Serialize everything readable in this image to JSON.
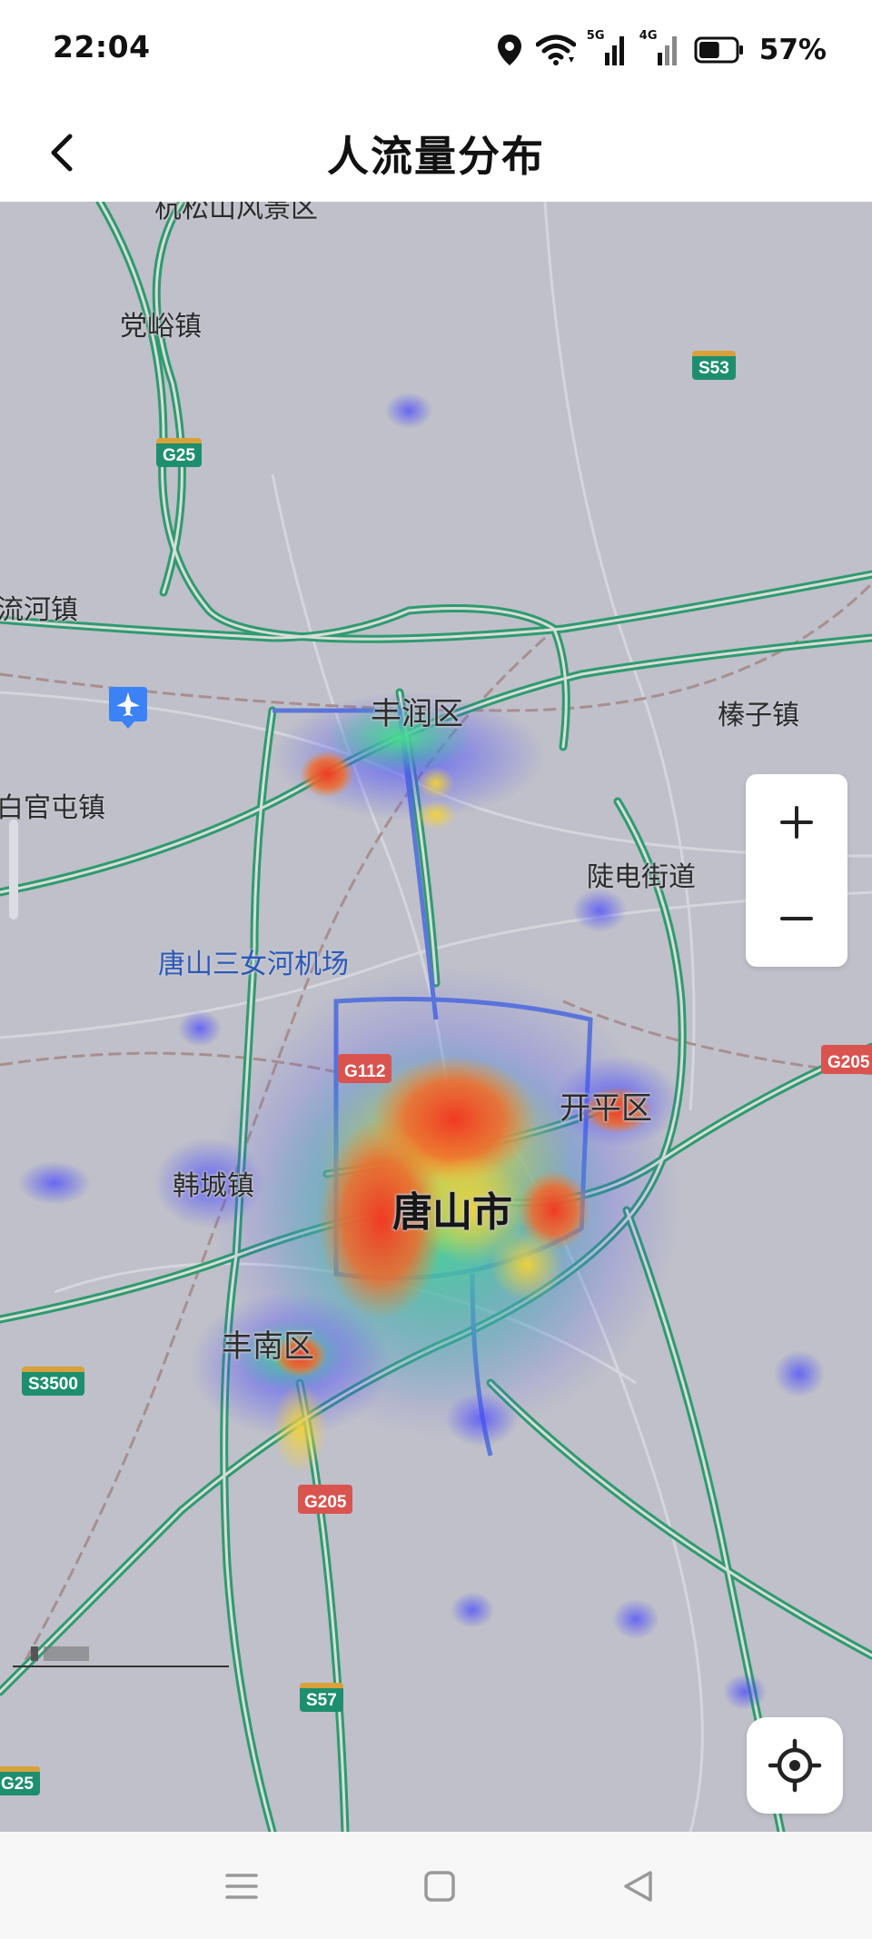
{
  "status_bar": {
    "time": "22:04",
    "icons": [
      "location-icon",
      "wifi-icon",
      "signal-5g-icon",
      "signal-4g-icon",
      "battery-icon"
    ],
    "signal_1_tag": "5G",
    "signal_2_tag": "4G",
    "battery_percent": "57%",
    "battery_level": 0.57
  },
  "header": {
    "title": "人流量分布",
    "back_icon": "chevron-left-icon"
  },
  "map": {
    "places": {
      "top_partial": "杭松山风景区",
      "dangyu": "党峪镇",
      "liuhe": "流河镇",
      "fengrun": "丰润区",
      "zhenzi": "榛子镇",
      "baiguantun": "白官屯镇",
      "ludian": "陡电街道",
      "airport": "唐山三女河机场",
      "kaiping": "开平区",
      "hancheng": "韩城镇",
      "tangshan": "唐山市",
      "fengnan": "丰南区"
    },
    "shields": {
      "s53": "S53",
      "g25_top": "G25",
      "g112": "G112",
      "g205_right": "G205",
      "s3500": "S3500",
      "g205_bottom": "G205",
      "s57": "S57",
      "g25_bottom": "G25"
    },
    "colors": {
      "land": "#bfc0c9",
      "expressway": "#2e9b6f",
      "heat_low": "#4f4fe0",
      "heat_mid": "#3ecf7a",
      "heat_high": "#f04a2a"
    }
  },
  "controls": {
    "zoom_in_icon": "plus-icon",
    "zoom_out_icon": "minus-icon",
    "locate_icon": "locate-target-icon"
  },
  "nav_bar": {
    "icons": [
      "menu-icon",
      "home-square-icon",
      "back-triangle-icon"
    ]
  }
}
